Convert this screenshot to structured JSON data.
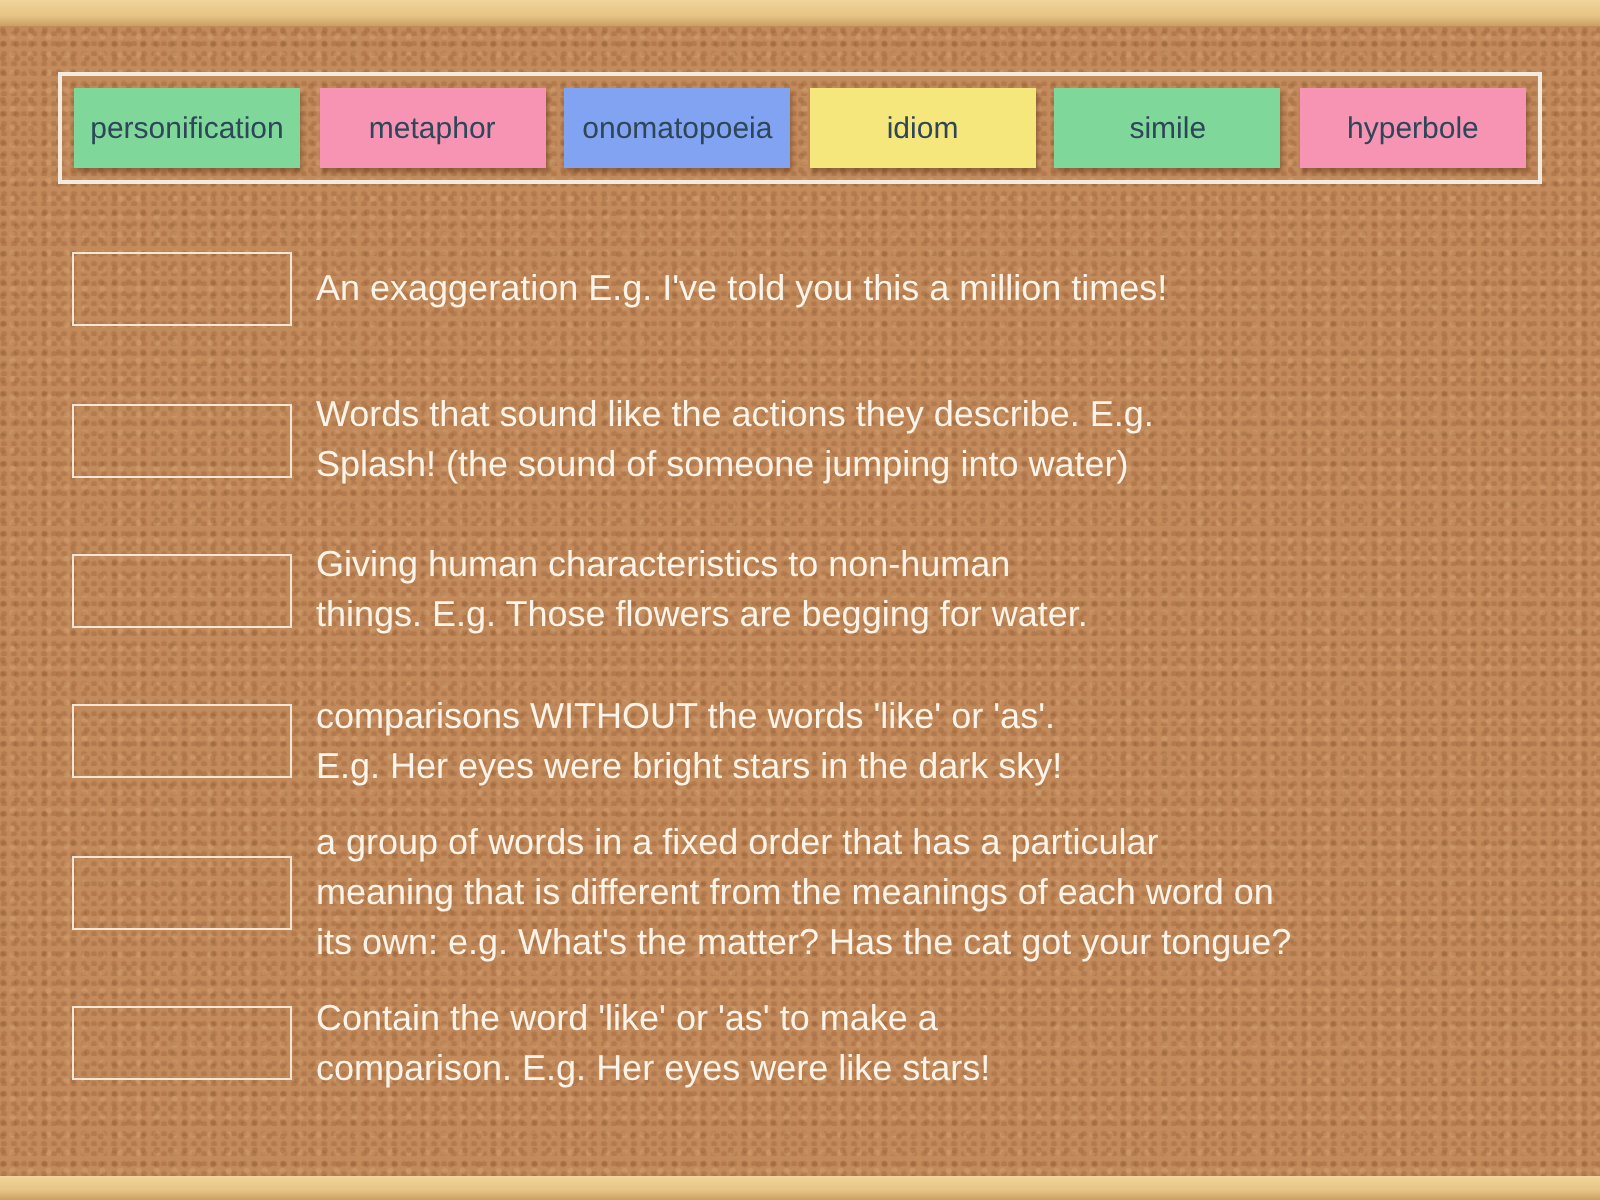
{
  "word_bank": {
    "tiles": [
      {
        "label": "personification",
        "color": "#7fd89a"
      },
      {
        "label": "metaphor",
        "color": "#f794b4"
      },
      {
        "label": "onomatopoeia",
        "color": "#82a2f2"
      },
      {
        "label": "idiom",
        "color": "#f5e77c"
      },
      {
        "label": "simile",
        "color": "#7fd89a"
      },
      {
        "label": "hyperbole",
        "color": "#f794b4"
      }
    ]
  },
  "definitions": [
    {
      "lines": [
        "An exaggeration E.g. I've told you this a million times!"
      ]
    },
    {
      "lines": [
        "Words that sound like the actions they describe. E.g.",
        "Splash! (the sound of someone jumping into water)"
      ]
    },
    {
      "lines": [
        "Giving human characteristics to non-human",
        "things. E.g. Those flowers are begging for water."
      ]
    },
    {
      "lines": [
        "comparisons WITHOUT the words 'like' or 'as'.",
        "E.g. Her eyes were bright stars in the dark sky!"
      ]
    },
    {
      "lines": [
        "a group of words in a fixed order that has a particular",
        "meaning that is different from the meanings of each word on",
        "its own: e.g. What's the matter? Has the cat got your tongue?"
      ]
    },
    {
      "lines": [
        "Contain the word 'like' or 'as' to make a",
        "comparison. E.g. Her eyes were like stars!"
      ]
    }
  ]
}
